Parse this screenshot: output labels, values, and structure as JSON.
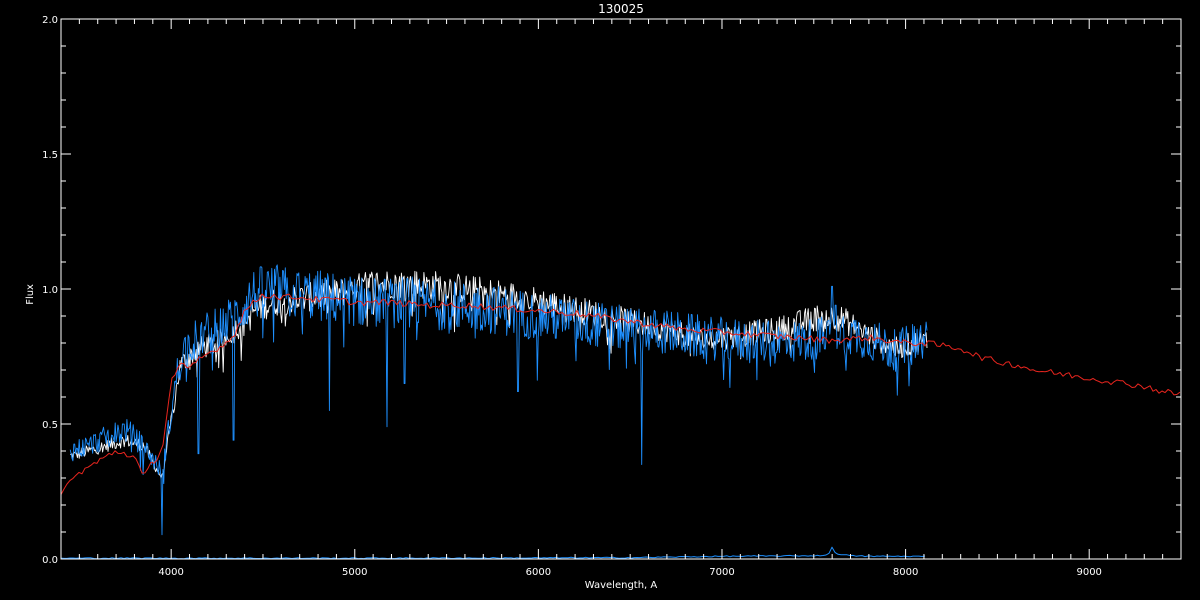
{
  "chart_data": {
    "type": "line",
    "title": "130025",
    "xlabel": "Wavelength, A",
    "ylabel": "Flux",
    "xlim": [
      3400,
      9500
    ],
    "ylim": [
      0.0,
      2.0
    ],
    "x_ticks": [
      4000,
      5000,
      6000,
      7000,
      8000,
      9000
    ],
    "x_tick_labels": [
      "4000",
      "5000",
      "6000",
      "7000",
      "8000",
      "9000"
    ],
    "y_ticks": [
      0.0,
      0.5,
      1.0,
      1.5,
      2.0
    ],
    "y_tick_labels": [
      "0.0",
      "0.5",
      "1.0",
      "1.5",
      "2.0"
    ],
    "grid": false,
    "background": "#000000",
    "axis_color": "#ffffff",
    "series": [
      {
        "color": "#ffffff",
        "style": "noisy-spectrum",
        "x": [
          3450,
          3550,
          3650,
          3750,
          3850,
          3950,
          4050,
          4150,
          4250,
          4350,
          4450,
          4550,
          4650,
          4750,
          4850,
          4950,
          5100,
          5300,
          5500,
          5700,
          5900,
          6100,
          6300,
          6500,
          6700,
          6900,
          7100,
          7300,
          7450,
          7550,
          7650,
          7750,
          7850,
          7950,
          8050,
          8120
        ],
        "y": [
          0.38,
          0.4,
          0.42,
          0.44,
          0.42,
          0.3,
          0.72,
          0.78,
          0.8,
          0.85,
          0.92,
          0.95,
          0.96,
          0.97,
          0.98,
          0.99,
          1.02,
          1.02,
          1.01,
          0.99,
          0.97,
          0.94,
          0.91,
          0.88,
          0.85,
          0.81,
          0.83,
          0.85,
          0.88,
          0.9,
          0.89,
          0.85,
          0.81,
          0.78,
          0.8,
          0.81
        ],
        "amp": 0.05
      },
      {
        "color": "#1e90ff",
        "style": "noisy-spectrum",
        "x": [
          3450,
          3550,
          3650,
          3750,
          3850,
          3950,
          4050,
          4150,
          4250,
          4350,
          4450,
          4550,
          4650,
          4750,
          4850,
          4950,
          5100,
          5300,
          5500,
          5700,
          5900,
          6100,
          6300,
          6500,
          6700,
          6900,
          7100,
          7300,
          7450,
          7550,
          7650,
          7750,
          7850,
          7950,
          8050,
          8120
        ],
        "y": [
          0.4,
          0.42,
          0.45,
          0.48,
          0.42,
          0.32,
          0.76,
          0.82,
          0.85,
          0.9,
          0.98,
          1.0,
          0.98,
          0.98,
          0.97,
          0.96,
          0.95,
          0.95,
          0.94,
          0.93,
          0.91,
          0.89,
          0.87,
          0.85,
          0.84,
          0.82,
          0.81,
          0.8,
          0.81,
          0.82,
          0.84,
          0.83,
          0.8,
          0.77,
          0.8,
          0.82
        ],
        "amp": 0.09,
        "spikes": [
          [
            3950,
            0.09
          ],
          [
            4150,
            0.39
          ],
          [
            4340,
            0.44
          ],
          [
            4861,
            0.55
          ],
          [
            5175,
            0.49
          ],
          [
            5270,
            0.65
          ],
          [
            5890,
            0.62
          ],
          [
            6563,
            0.35
          ],
          [
            7600,
            1.01
          ],
          [
            7620,
            0.94
          ]
        ]
      },
      {
        "color": "#e8251e",
        "style": "line",
        "x": [
          3400,
          3500,
          3600,
          3700,
          3800,
          3850,
          3900,
          3950,
          4000,
          4050,
          4100,
          4150,
          4200,
          4250,
          4300,
          4350,
          4400,
          4500,
          4600,
          4700,
          4800,
          4900,
          5000,
          5200,
          5400,
          5600,
          5800,
          6000,
          6200,
          6400,
          6600,
          6800,
          7000,
          7200,
          7400,
          7600,
          7800,
          8000,
          8100,
          8200,
          8300,
          8400,
          8500,
          8600,
          8700,
          8800,
          8900,
          9000,
          9100,
          9200,
          9300,
          9400,
          9500
        ],
        "y": [
          0.25,
          0.32,
          0.36,
          0.4,
          0.38,
          0.3,
          0.36,
          0.4,
          0.66,
          0.72,
          0.7,
          0.74,
          0.76,
          0.78,
          0.8,
          0.84,
          0.92,
          0.98,
          0.97,
          0.97,
          0.96,
          0.96,
          0.95,
          0.95,
          0.94,
          0.94,
          0.93,
          0.92,
          0.91,
          0.89,
          0.87,
          0.85,
          0.84,
          0.83,
          0.82,
          0.81,
          0.82,
          0.8,
          0.8,
          0.79,
          0.78,
          0.75,
          0.73,
          0.72,
          0.7,
          0.69,
          0.68,
          0.67,
          0.66,
          0.65,
          0.64,
          0.62,
          0.61
        ],
        "amp": 0.012
      },
      {
        "color": "#1e90ff",
        "style": "line",
        "x": [
          3400,
          4000,
          5000,
          6000,
          6500,
          7000,
          7500,
          7580,
          7600,
          7620,
          7700,
          7800,
          8000,
          8120
        ],
        "y": [
          0.003,
          0.003,
          0.003,
          0.004,
          0.005,
          0.01,
          0.012,
          0.015,
          0.045,
          0.02,
          0.012,
          0.01,
          0.01,
          0.01
        ],
        "amp": 0.002
      }
    ]
  }
}
